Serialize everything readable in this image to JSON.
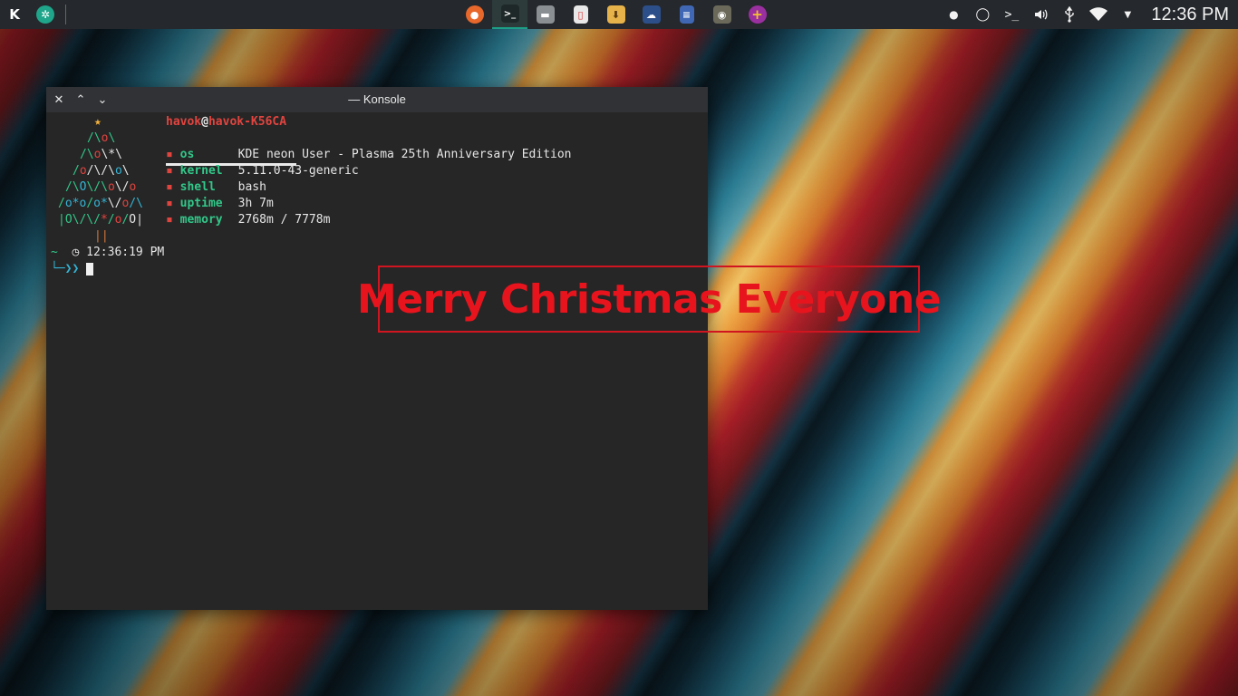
{
  "panel": {
    "launcher_glyph": "K",
    "pinned_app_glyph": "✲",
    "tasks": [
      {
        "name": "firefox",
        "glyph": "●",
        "color": "#e8672b"
      },
      {
        "name": "konsole",
        "glyph": ">_",
        "color": "#2c3a3a",
        "active": true
      },
      {
        "name": "archive-manager",
        "glyph": "▬",
        "color": "#8a8f94"
      },
      {
        "name": "document-viewer",
        "glyph": "▯",
        "color": "#e8e8e8"
      },
      {
        "name": "downloader",
        "glyph": "⬇",
        "color": "#e6b24a"
      },
      {
        "name": "cloud-app",
        "glyph": "☁",
        "color": "#2c4f8a"
      },
      {
        "name": "text-editor",
        "glyph": "≡",
        "color": "#3f67b3"
      },
      {
        "name": "gimp",
        "glyph": "◉",
        "color": "#6b6a5a"
      },
      {
        "name": "first-aid-app",
        "glyph": "+",
        "color": "#9a2fa0"
      }
    ],
    "tray": [
      {
        "name": "drop-icon",
        "glyph": "💧"
      },
      {
        "name": "circle-icon",
        "glyph": "◯"
      },
      {
        "name": "terminal-icon",
        "glyph": ">_"
      },
      {
        "name": "volume-icon",
        "glyph": "🔊"
      },
      {
        "name": "usb-icon",
        "glyph": "⚲"
      },
      {
        "name": "wifi-icon",
        "glyph": "◠"
      },
      {
        "name": "expand-tray-icon",
        "glyph": "▼"
      }
    ],
    "clock": "12:36 PM"
  },
  "window": {
    "title": "— Konsole",
    "close_glyph": "✕",
    "minimize_glyph": "⌃",
    "maximize_glyph": "⌄"
  },
  "terminal": {
    "user": "havok",
    "at": "@",
    "host": "havok-K56CA",
    "info": [
      {
        "key": "os",
        "value": "KDE neon User - Plasma 25th Anniversary Edition"
      },
      {
        "key": "kernel",
        "value": "5.11.0-43-generic"
      },
      {
        "key": "shell",
        "value": "bash"
      },
      {
        "key": "uptime",
        "value": "3h 7m"
      },
      {
        "key": "memory",
        "value": "2768m / 7778m"
      }
    ],
    "bullet": "▪",
    "tree": {
      "star": "★",
      "row1": "/\\o\\",
      "row2": "/\\o\\*\\",
      "row3": "/o/\\/\\o\\",
      "row4": "/\\O\\/\\o\\/o",
      "row5": "/o*o/o*\\/o/\\",
      "row6": "|O\\/\\/*/o/O|",
      "trunk": "||"
    },
    "prompt_tilde": "~",
    "prompt_clock_icon": "◷",
    "prompt_time": "12:36:19 PM",
    "prompt_arrow": "└─❯❯"
  },
  "overlay": {
    "greeting": "Merry Christmas Everyone"
  },
  "colors": {
    "accent": "#1d9e86",
    "greeting_red": "#e8141d"
  }
}
